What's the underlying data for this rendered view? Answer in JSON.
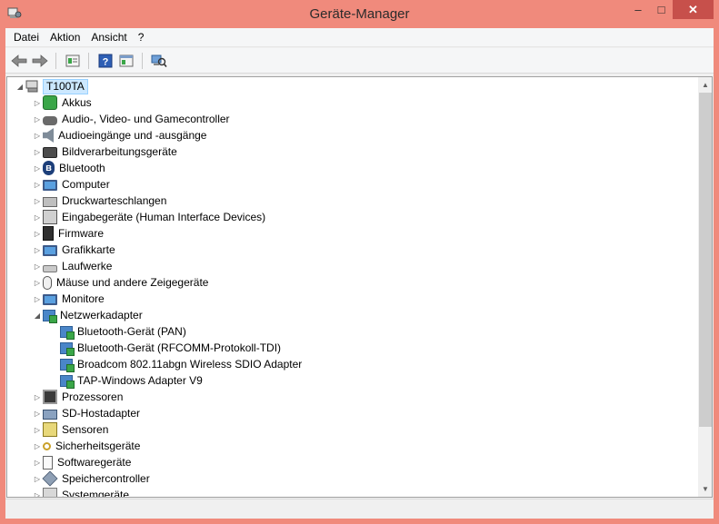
{
  "window": {
    "title": "Geräte-Manager",
    "title_bar_color": "#f08a7c",
    "close_color": "#c7504b",
    "controls": {
      "minimize": "–",
      "maximize": "□",
      "close": "✕"
    }
  },
  "menu": {
    "items": [
      "Datei",
      "Aktion",
      "Ansicht",
      "?"
    ]
  },
  "toolbar": {
    "buttons": [
      {
        "name": "back-icon",
        "glyph": "⇦"
      },
      {
        "name": "forward-icon",
        "glyph": "⇨"
      },
      {
        "name": "properties-icon",
        "glyph": "▤"
      },
      {
        "name": "help-icon",
        "glyph": "?"
      },
      {
        "name": "view-icon",
        "glyph": "▦"
      },
      {
        "name": "scan-hardware-icon",
        "glyph": "⌕"
      }
    ]
  },
  "tree": {
    "root": {
      "label": "T100TA",
      "expanded": true,
      "icon": "computer-icon"
    },
    "items": [
      {
        "label": "Akkus",
        "icon": "battery-icon",
        "expanded": false
      },
      {
        "label": "Audio-, Video- und Gamecontroller",
        "icon": "gamepad-icon",
        "expanded": false
      },
      {
        "label": "Audioeingänge und -ausgänge",
        "icon": "speaker-icon",
        "expanded": false
      },
      {
        "label": "Bildverarbeitungsgeräte",
        "icon": "camera-icon",
        "expanded": false
      },
      {
        "label": "Bluetooth",
        "icon": "bluetooth-icon",
        "expanded": false
      },
      {
        "label": "Computer",
        "icon": "computer-icon",
        "expanded": false
      },
      {
        "label": "Druckwarteschlangen",
        "icon": "printer-icon",
        "expanded": false
      },
      {
        "label": "Eingabegeräte (Human Interface Devices)",
        "icon": "keyboard-icon",
        "expanded": false
      },
      {
        "label": "Firmware",
        "icon": "firmware-icon",
        "expanded": false
      },
      {
        "label": "Grafikkarte",
        "icon": "display-adapter-icon",
        "expanded": false
      },
      {
        "label": "Laufwerke",
        "icon": "drive-icon",
        "expanded": false
      },
      {
        "label": "Mäuse und andere Zeigegeräte",
        "icon": "mouse-icon",
        "expanded": false
      },
      {
        "label": "Monitore",
        "icon": "monitor-icon",
        "expanded": false
      },
      {
        "label": "Netzwerkadapter",
        "icon": "network-adapter-icon",
        "expanded": true,
        "children": [
          {
            "label": "Bluetooth-Gerät (PAN)",
            "icon": "network-adapter-icon"
          },
          {
            "label": "Bluetooth-Gerät (RFCOMM-Protokoll-TDI)",
            "icon": "network-adapter-icon"
          },
          {
            "label": "Broadcom 802.11abgn Wireless SDIO Adapter",
            "icon": "network-adapter-icon"
          },
          {
            "label": "TAP-Windows Adapter V9",
            "icon": "network-adapter-icon"
          }
        ]
      },
      {
        "label": "Prozessoren",
        "icon": "processor-icon",
        "expanded": false
      },
      {
        "label": "SD-Hostadapter",
        "icon": "sd-host-icon",
        "expanded": false
      },
      {
        "label": "Sensoren",
        "icon": "sensor-icon",
        "expanded": false
      },
      {
        "label": "Sicherheitsgeräte",
        "icon": "security-key-icon",
        "expanded": false
      },
      {
        "label": "Softwaregeräte",
        "icon": "software-device-icon",
        "expanded": false
      },
      {
        "label": "Speichercontroller",
        "icon": "storage-controller-icon",
        "expanded": false
      },
      {
        "label": "Systemgeräte",
        "icon": "system-device-icon",
        "expanded": false
      }
    ],
    "selection_color": "#cce8ff"
  },
  "scrollbar": {
    "up": "▲",
    "down": "▼"
  }
}
